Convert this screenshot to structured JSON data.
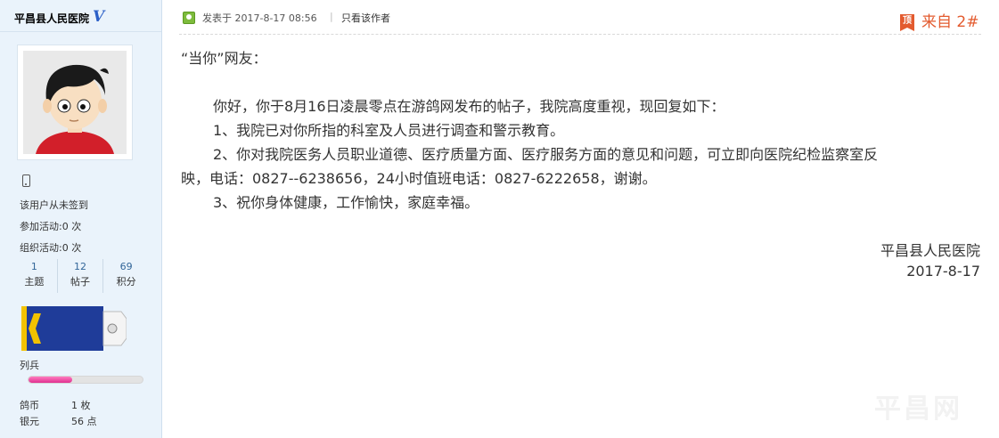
{
  "author": {
    "name": "平昌县人民医院",
    "vip_icon": "V",
    "checkin_status": "该用户从未签到",
    "activities_joined_label": "参加活动:",
    "activities_joined": "0 次",
    "activities_organized_label": "组织活动:",
    "activities_organized": "0 次",
    "stats": [
      {
        "value": "1",
        "label": "主题"
      },
      {
        "value": "12",
        "label": "帖子"
      },
      {
        "value": "69",
        "label": "积分"
      }
    ],
    "rank": "列兵",
    "rank_progress": 0.38,
    "coins_label": "鸽币",
    "coins": "1 枚",
    "silver_label": "银元",
    "silver": "56 点"
  },
  "post": {
    "posted_at": "发表于 2017-8-17 08:56",
    "separator": "|",
    "only_author": "只看该作者",
    "ding_icon_text": "顶",
    "floor": "来自 2#",
    "greeting": "“当你”网友：",
    "lines": [
      "你好，你于8月16日凌晨零点在游鸽网发布的帖子，我院高度重视，现回复如下：",
      "1、我院已对你所指的科室及人员进行调查和警示教育。",
      "2、你对我院医务人员职业道德、医疗质量方面、医疗服务方面的意见和问题，可立即向医院纪检监察室反",
      "映，电话：0827--6238656，24小时值班电话：0827-6222658，谢谢。",
      "3、祝你身体健康，工作愉快，家庭幸福。"
    ],
    "signature_org": "平昌县人民医院",
    "signature_date": "2017-8-17",
    "watermark": "平昌网"
  },
  "colors": {
    "sidebar_bg": "#eaf3fb",
    "accent_orange": "#e35b2f",
    "vip_blue": "#2b5fc7",
    "exp_pink": "#e02f8f"
  }
}
